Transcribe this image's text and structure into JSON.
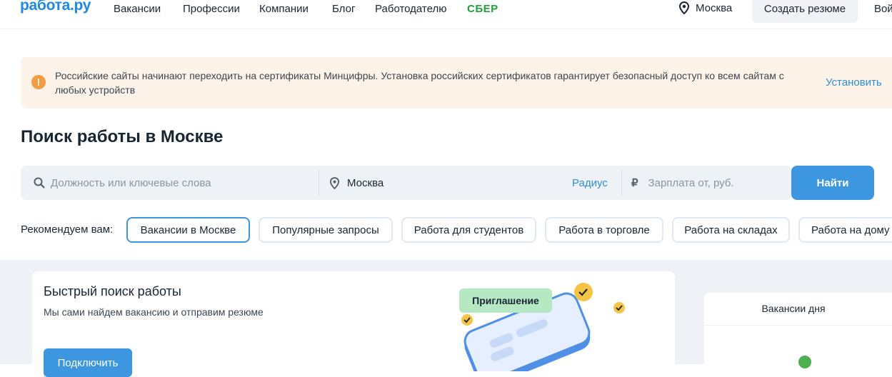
{
  "header": {
    "logo": "работа.ру",
    "nav": [
      "Вакансии",
      "Профессии",
      "Компании",
      "Блог",
      "Работодателю"
    ],
    "sber": "СБЕР",
    "city": "Москва",
    "create_resume": "Создать резюме",
    "login": "Вой"
  },
  "alert": {
    "text": "Российские сайты начинают переходить на сертификаты Минцифры. Установка российских сертификатов гарантирует безопасный доступ ко всем сайтам с любых устройств",
    "action": "Установить",
    "icon": "exclamation-icon"
  },
  "page_title": "Поиск работы в Москве",
  "search": {
    "keyword_placeholder": "Должность или ключевые слова",
    "city_value": "Москва",
    "radius_label": "Радиус",
    "salary_placeholder": "Зарплата от, руб.",
    "currency_symbol": "₽",
    "submit_label": "Найти"
  },
  "recommendations": {
    "label": "Рекомендуем вам:",
    "chips": [
      "Вакансии в Москве",
      "Популярные запросы",
      "Работа для студентов",
      "Работа в торговле",
      "Работа на складах",
      "Работа на дому"
    ]
  },
  "quick_search": {
    "title": "Быстрый поиск работы",
    "subtitle": "Мы сами найдем вакансию и отправим резюме",
    "button": "Подключить",
    "invite_label": "Приглашение"
  },
  "vacancies_of_day": {
    "title": "Вакансии дня"
  },
  "colors": {
    "brand": "#1e88e5",
    "accent": "#3d96e0",
    "sber": "#21a038",
    "alert_bg": "#fdf3e8",
    "alert_icon": "#f59c42"
  }
}
